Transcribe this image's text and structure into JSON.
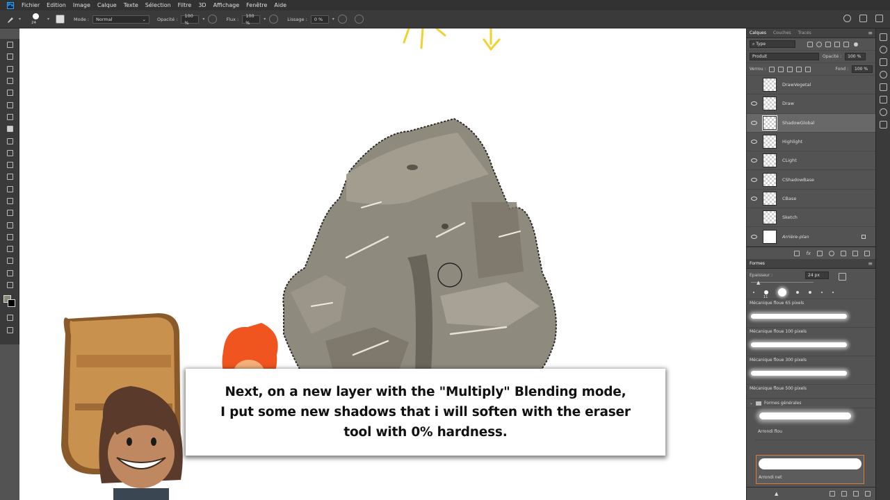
{
  "menubar": {
    "app_icon": "Ps",
    "items": [
      "Fichier",
      "Edition",
      "Image",
      "Calque",
      "Texte",
      "Sélection",
      "Filtre",
      "3D",
      "Affichage",
      "Fenêtre",
      "Aide"
    ]
  },
  "options": {
    "brush_size": "24",
    "mode_label": "Mode :",
    "mode_value": "Normal",
    "opacity_label": "Opacité :",
    "opacity_value": "100 %",
    "flow_label": "Flux :",
    "flow_value": "100 %",
    "smoothing_label": "Lissage :",
    "smoothing_value": "0 %"
  },
  "tools": [
    "move-tool",
    "marquee-tool",
    "lasso-tool",
    "magic-wand-tool",
    "crop-tool",
    "eyedropper-tool",
    "healing-tool",
    "brush-tool",
    "stamp-tool",
    "history-brush-tool",
    "eraser-tool",
    "bucket-tool",
    "blur-tool",
    "dodge-tool",
    "pen-tool",
    "type-tool",
    "path-select-tool",
    "shape-tool",
    "hand-tool",
    "zoom-tool",
    "more-tools-tool"
  ],
  "layers_panel": {
    "tabs": [
      "Calques",
      "Couches",
      "Tracés"
    ],
    "filter_value": "Type",
    "blend_value": "Produit",
    "opacity_label": "Opacité :",
    "opacity_value": "100 %",
    "lock_label": "Verrou :",
    "fill_label": "Fond :",
    "fill_value": "100 %",
    "layers": [
      {
        "name": "DrawVegetal",
        "visible": false
      },
      {
        "name": "Draw",
        "visible": true
      },
      {
        "name": "ShadowGlobal",
        "visible": true,
        "selected": true
      },
      {
        "name": "Highlight",
        "visible": true
      },
      {
        "name": "CLight",
        "visible": true
      },
      {
        "name": "CShadowBase",
        "visible": true
      },
      {
        "name": "CBase",
        "visible": true
      },
      {
        "name": "Sketch",
        "visible": false
      },
      {
        "name": "Arrière-plan",
        "visible": true,
        "locked": true
      }
    ]
  },
  "brushes_panel": {
    "title": "Formes",
    "size_label": "Epaisseur :",
    "size_value": "24 px",
    "preset_size": "11",
    "brushes": [
      {
        "name": "Mécanique floue 65 pixels"
      },
      {
        "name": "Mécanique floue 100 pixels"
      },
      {
        "name": "Mécanique floue 300 pixels"
      },
      {
        "name": "Mécanique floue 500 pixels"
      }
    ],
    "group_name": "Formes générales",
    "group_brushes": [
      "Arrondi flou",
      "Arrondi net"
    ]
  },
  "caption": {
    "text": "Next, on a new layer with the \"Multiply\" Blending mode,\nI put some new shadows that i will soften with the eraser\ntool with 0% hardness."
  },
  "colors": {
    "app_bg": "#535353",
    "panel_bg": "#3a3a3a",
    "menubar_bg": "#323232",
    "canvas_bg": "#ffffff",
    "rock": "#8f8a7e",
    "hair": "#f0551f",
    "highlight_border": "#e07a3a"
  }
}
